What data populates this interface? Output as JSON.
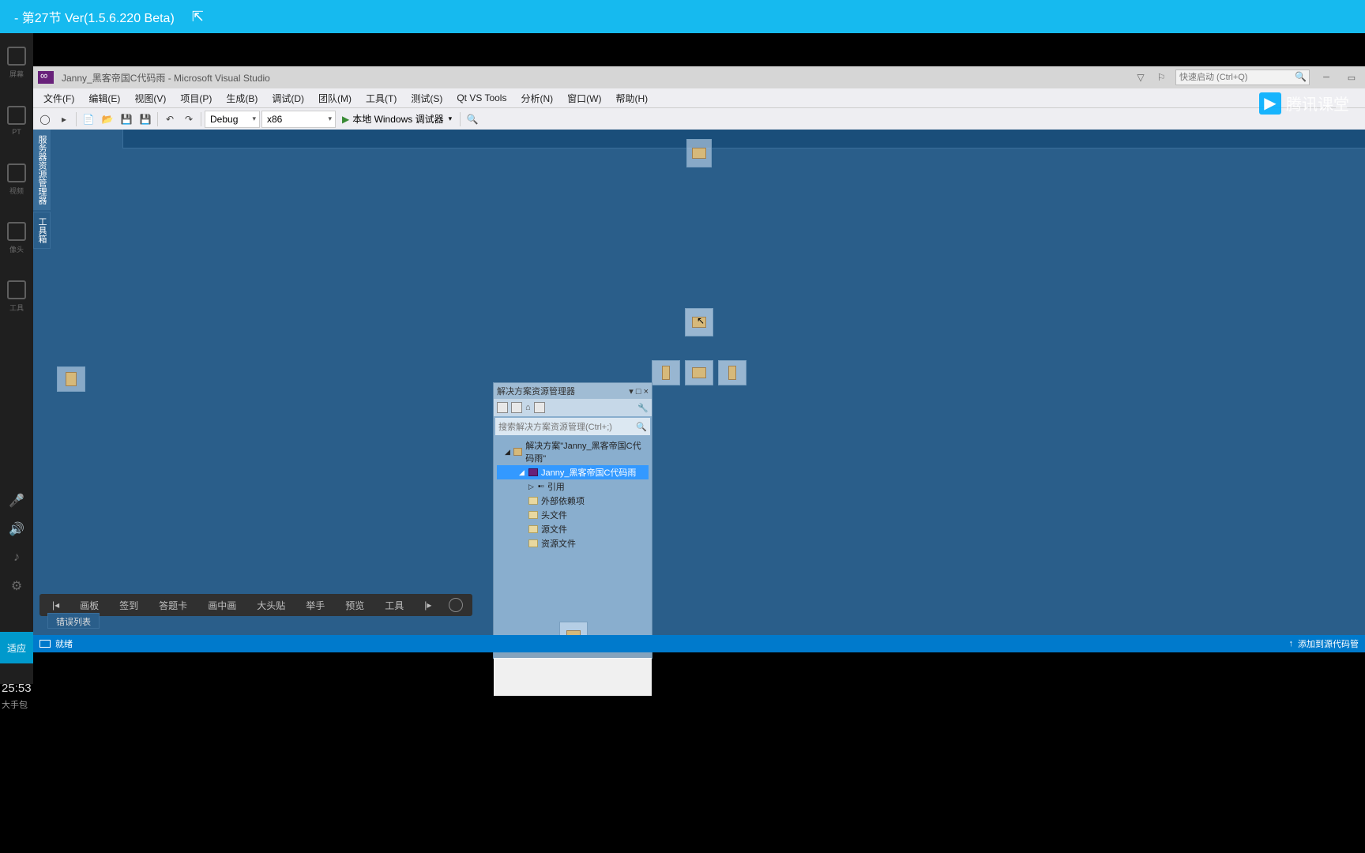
{
  "player": {
    "title": "- 第27节 Ver(1.5.6.220 Beta)",
    "sidebar": [
      "屏幕",
      "PT",
      "视频",
      "像头",
      "工具"
    ],
    "adapt": "适应",
    "time": "25:53",
    "sub": "大手包"
  },
  "vs": {
    "title": "Janny_黑客帝国C代码雨 - Microsoft Visual Studio",
    "search_placeholder": "快速启动 (Ctrl+Q)",
    "menus": [
      "文件(F)",
      "编辑(E)",
      "视图(V)",
      "项目(P)",
      "生成(B)",
      "调试(D)",
      "团队(M)",
      "工具(T)",
      "测试(S)",
      "Qt VS Tools",
      "分析(N)",
      "窗口(W)",
      "帮助(H)"
    ],
    "config": "Debug",
    "platform": "x86",
    "run_label": "本地 Windows 调试器",
    "left_tabs": [
      "服务器资源管理器",
      "工具箱"
    ],
    "err_tab": "错误列表",
    "status_ready": "就绪",
    "status_right": "添加到源代码管"
  },
  "solution_panel": {
    "title": "解决方案资源管理器",
    "search_placeholder": "搜索解决方案资源管理(Ctrl+;)",
    "root": "解决方案\"Janny_黑客帝国C代码雨\"",
    "project": "Janny_黑客帝国C代码雨",
    "nodes": [
      "引用",
      "外部依赖项",
      "头文件",
      "源文件",
      "资源文件"
    ]
  },
  "wb": {
    "items": [
      "画板",
      "签到",
      "答题卡",
      "画中画",
      "大头贴",
      "举手",
      "预览",
      "工具"
    ]
  },
  "tencent": "腾讯课堂"
}
